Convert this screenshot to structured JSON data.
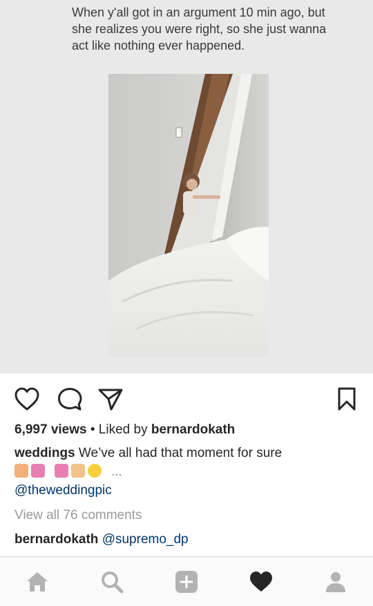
{
  "post": {
    "meme_text": "When y'all got in an argument 10 min ago, but she realizes you were right, so she just wanna act like nothing ever happened."
  },
  "actions": {
    "like_icon": "heart-outline-icon",
    "comment_icon": "comment-bubble-icon",
    "share_icon": "paper-plane-icon",
    "save_icon": "bookmark-icon"
  },
  "stats": {
    "views": "6,997 views",
    "separator": " • Liked by ",
    "liked_by": "bernardokath"
  },
  "caption": {
    "username": "weddings",
    "text": "We’ve all had that moment for sure",
    "more": "...",
    "mention": "@theweddingpic"
  },
  "comments": {
    "view_all": "View all 76 comments",
    "items": [
      {
        "username": "bernardokath",
        "text": "@supremo_dp"
      }
    ]
  },
  "nav": {
    "icons": [
      "home-icon",
      "search-icon",
      "add-post-icon",
      "activity-heart-icon",
      "profile-icon"
    ]
  },
  "colors": {
    "text": "#262626",
    "link": "#003569",
    "muted": "#999999",
    "nav_icon": "#b3b3b3",
    "nav_active": "#262626"
  }
}
